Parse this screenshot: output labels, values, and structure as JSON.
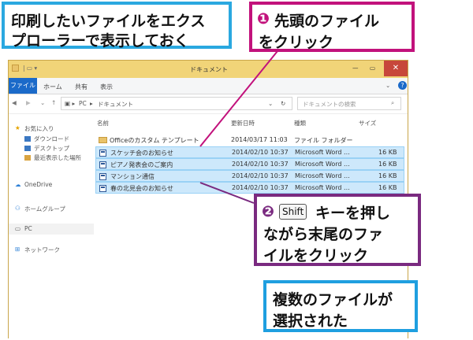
{
  "callouts": {
    "top_left": {
      "line1": "印刷したいファイルをエクス",
      "line2": "プローラーで表示しておく"
    },
    "step1": {
      "num": "❶",
      "line1": "先頭のファイル",
      "line2": "をクリック"
    },
    "step2": {
      "num": "❷",
      "key": "Shift",
      "line1": "キーを押し",
      "line2": "ながら末尾のファ",
      "line3": "イルをクリック"
    },
    "result": {
      "line1": "複数のファイルが",
      "line2": "選択された"
    }
  },
  "window": {
    "title": "ドキュメント",
    "ribbon_tabs": [
      "ファイル",
      "ホーム",
      "共有",
      "表示"
    ],
    "path": [
      "PC",
      "ドキュメント"
    ],
    "search_placeholder": "ドキュメントの検索",
    "columns": [
      "名前",
      "更新日時",
      "種類",
      "サイズ"
    ],
    "nav": {
      "favorites": "お気に入り",
      "downloads": "ダウンロード",
      "desktop": "デスクトップ",
      "recent": "最近表示した場所",
      "onedrive": "OneDrive",
      "homegroup": "ホームグループ",
      "pc": "PC",
      "network": "ネットワーク"
    },
    "files": [
      {
        "name": "Officeのカスタム テンプレート",
        "date": "2014/03/17 11:03",
        "type": "ファイル フォルダー",
        "size": "",
        "kind": "folder"
      },
      {
        "name": "スケッチ会のお知らせ",
        "date": "2014/02/10 10:37",
        "type": "Microsoft Word ...",
        "size": "16 KB",
        "kind": "doc"
      },
      {
        "name": "ピアノ発表会のご案内",
        "date": "2014/02/10 10:37",
        "type": "Microsoft Word ...",
        "size": "16 KB",
        "kind": "doc"
      },
      {
        "name": "マンション通信",
        "date": "2014/02/10 10:37",
        "type": "Microsoft Word ...",
        "size": "16 KB",
        "kind": "doc"
      },
      {
        "name": "春の北見会のお知らせ",
        "date": "2014/02/10 10:37",
        "type": "Microsoft Word ...",
        "size": "16 KB",
        "kind": "doc"
      }
    ]
  },
  "colors": {
    "callout_blue": "#2aa8e0",
    "callout_magenta": "#c2127c",
    "callout_purple": "#7a2a80",
    "selection": "#cde8fb"
  }
}
